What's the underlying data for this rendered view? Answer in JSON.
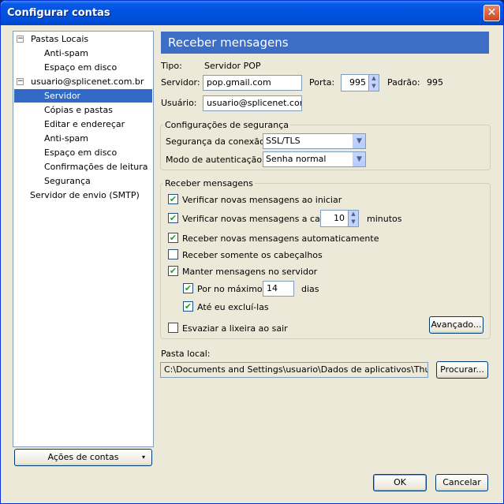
{
  "window": {
    "title": "Configurar contas",
    "close_glyph": "✕"
  },
  "sidebar": {
    "items": [
      {
        "label": "Pastas Locais"
      },
      {
        "label": "Anti-spam"
      },
      {
        "label": "Espaço em disco"
      },
      {
        "label": "usuario@splicenet.com.br"
      },
      {
        "label": "Servidor"
      },
      {
        "label": "Cópias e pastas"
      },
      {
        "label": "Editar e endereçar"
      },
      {
        "label": "Anti-spam"
      },
      {
        "label": "Espaço em disco"
      },
      {
        "label": "Confirmações de leitura"
      },
      {
        "label": "Segurança"
      },
      {
        "label": "Servidor de envio (SMTP)"
      }
    ],
    "actions_button": "Ações de contas",
    "expander_glyph": "−"
  },
  "panel": {
    "title": "Receber mensagens",
    "tipo_label": "Tipo:",
    "tipo_value": "Servidor POP",
    "servidor_label": "Servidor:",
    "servidor_value": "pop.gmail.com",
    "porta_label": "Porta:",
    "porta_value": "995",
    "padrao_label": "Padrão:",
    "padrao_value": "995",
    "usuario_label": "Usuário:",
    "usuario_value": "usuario@splicenet.com.b"
  },
  "security": {
    "title": "Configurações de segurança",
    "conexao_label": "Segurança da conexão:",
    "conexao_value": "SSL/TLS",
    "auth_label": "Modo de autenticação:",
    "auth_value": "Senha normal"
  },
  "receive": {
    "title": "Receber mensagens",
    "check_start": "Verificar novas mensagens ao iniciar",
    "check_every": "Verificar novas mensagens a cada",
    "check_every_value": "10",
    "minutes": "minutos",
    "auto_download": "Receber novas mensagens automaticamente",
    "headers_only": "Receber somente os cabeçalhos",
    "leave_on_server": "Manter mensagens no servidor",
    "max_days_label": "Por no máximo",
    "max_days_value": "14",
    "days": "dias",
    "until_deleted": "Até eu excluí-las",
    "empty_trash": "Esvaziar a lixeira ao sair",
    "advanced_button": "Avançado..."
  },
  "local_folder": {
    "label": "Pasta local:",
    "path": "C:\\Documents and Settings\\usuario\\Dados de aplicativos\\Thunderbird",
    "browse_button": "Procurar..."
  },
  "footer": {
    "ok": "OK",
    "cancel": "Cancelar"
  },
  "glyphs": {
    "check": "✔",
    "up": "▲",
    "down": "▼",
    "dropdown": "▾"
  }
}
